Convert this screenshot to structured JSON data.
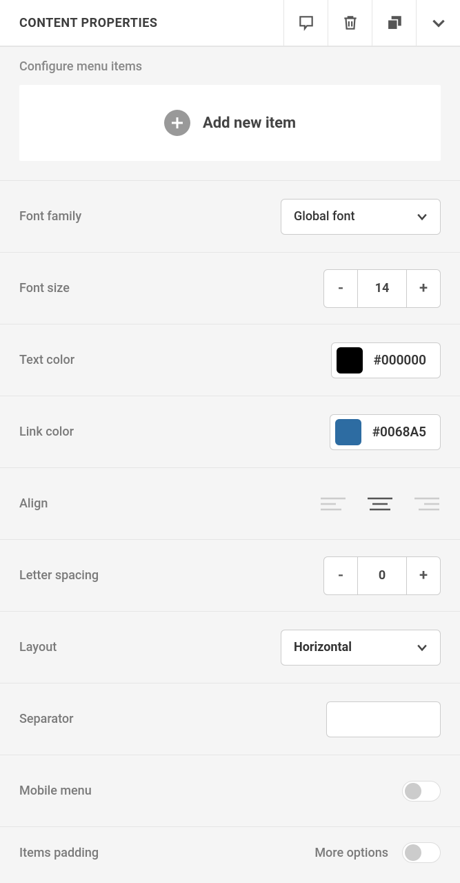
{
  "header": {
    "title": "CONTENT PROPERTIES"
  },
  "config": {
    "label": "Configure menu items",
    "add_label": "Add new item"
  },
  "rows": {
    "font_family": {
      "label": "Font family",
      "value": "Global font"
    },
    "font_size": {
      "label": "Font size",
      "value": "14",
      "minus": "-",
      "plus": "+"
    },
    "text_color": {
      "label": "Text color",
      "hex": "#000000",
      "swatch": "#000000"
    },
    "link_color": {
      "label": "Link color",
      "hex": "#0068A5",
      "swatch": "#2d6ca2"
    },
    "align": {
      "label": "Align",
      "value": "center"
    },
    "letter_spacing": {
      "label": "Letter spacing",
      "value": "0",
      "minus": "-",
      "plus": "+"
    },
    "layout": {
      "label": "Layout",
      "value": "Horizontal"
    },
    "separator": {
      "label": "Separator",
      "value": ""
    },
    "mobile_menu": {
      "label": "Mobile menu",
      "on": false
    },
    "items_padding": {
      "label": "Items padding",
      "more": "More options",
      "on": false
    }
  }
}
